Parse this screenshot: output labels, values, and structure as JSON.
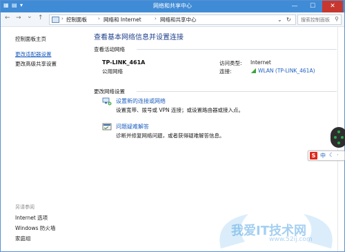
{
  "window": {
    "title": "网络和共享中心",
    "minimize_glyph": "—",
    "maximize_glyph": "☐",
    "close_glyph": "✕"
  },
  "address_bar": {
    "back_glyph": "←",
    "forward_glyph": "→",
    "down_glyph": "⌄",
    "up_glyph": "↑",
    "breadcrumbs": [
      "控制面板",
      "网络和 Internet",
      "网络和共享中心"
    ],
    "separator": "›",
    "refresh_glyph": "↻",
    "search_placeholder": "搜索控制面板",
    "search_glyph": "⚲"
  },
  "sidebar": {
    "links": [
      {
        "label": "控制面板主页",
        "active": false
      },
      {
        "label": "更改适配器设置",
        "active": true
      },
      {
        "label": "更改高级共享设置",
        "active": false
      }
    ],
    "see_also_heading": "另请参阅",
    "see_also_links": [
      {
        "label": "Internet 选项"
      },
      {
        "label": "Windows 防火墙"
      },
      {
        "label": "家庭组"
      }
    ]
  },
  "main": {
    "heading": "查看基本网络信息并设置连接",
    "active_networks_title": "查看活动网络",
    "network": {
      "name": "TP-LINK_461A",
      "type": "公用网络",
      "access_type_label": "访问类型:",
      "access_type_value": "Internet",
      "connection_label": "连接:",
      "connection_value": "WLAN (TP-LINK_461A)"
    },
    "change_settings_title": "更改网络设置",
    "tasks": [
      {
        "icon": "network-setup-icon",
        "link": "设置新的连接或网络",
        "desc": "设置宽带、拨号或 VPN 连接；或设置路由器或接入点。"
      },
      {
        "icon": "troubleshoot-icon",
        "link": "问题疑难解答",
        "desc": "诊断并修复网络问题，或者获得疑难解答信息。"
      }
    ]
  },
  "overlays": {
    "ime": {
      "logo": "S",
      "mode": "中",
      "moon": "☾",
      "dot": "·"
    },
    "watermark": {
      "text": "我爱IT技术网",
      "url": "www.52ij.com"
    }
  },
  "colors": {
    "titlebar": "#3f8bd6",
    "link": "#1e5fbf",
    "heading": "#1e3f8b",
    "close_button": "#c7372f"
  }
}
